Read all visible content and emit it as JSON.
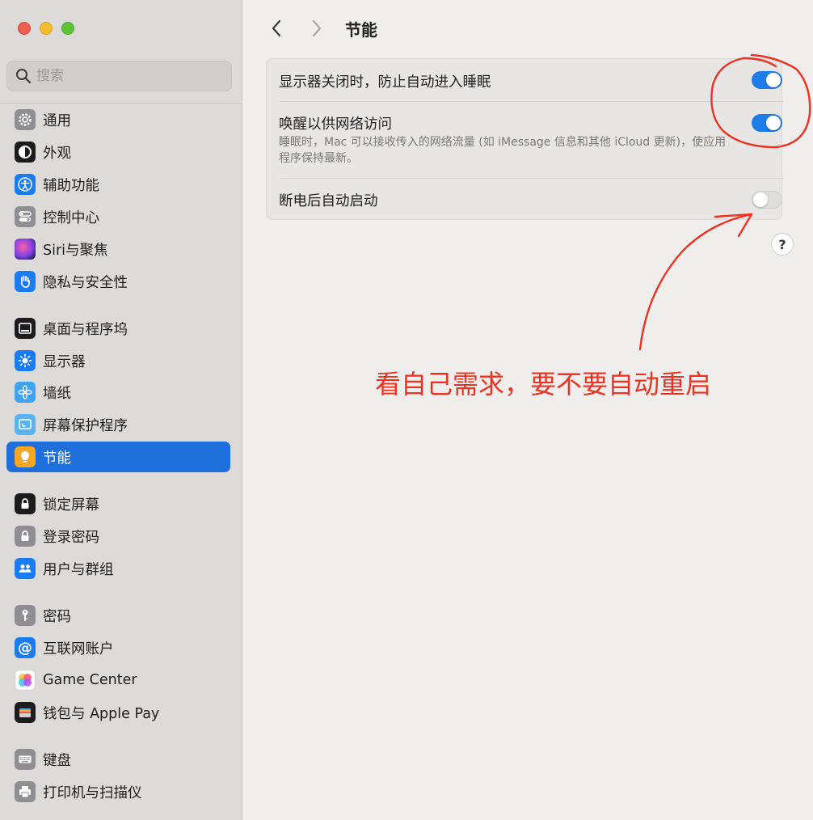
{
  "window": {
    "traffic_lights": [
      "close",
      "minimize",
      "zoom"
    ]
  },
  "search": {
    "placeholder": "搜索"
  },
  "sidebar": {
    "items": [
      {
        "label": "通用",
        "icon": "gear-icon",
        "color": "#8e8e93"
      },
      {
        "label": "外观",
        "icon": "appearance-icon",
        "color": "#1c1c1e"
      },
      {
        "label": "辅助功能",
        "icon": "accessibility-icon",
        "color": "#1a7cf2"
      },
      {
        "label": "控制中心",
        "icon": "control-center-icon",
        "color": "#8e8e93"
      },
      {
        "label": "Siri与聚焦",
        "icon": "siri-icon",
        "color": "#9b3fd0"
      },
      {
        "label": "隐私与安全性",
        "icon": "hand-icon",
        "color": "#1a7cf2"
      },
      {
        "label": "桌面与程序坞",
        "icon": "dock-icon",
        "color": "#1c1c1e"
      },
      {
        "label": "显示器",
        "icon": "sun-icon",
        "color": "#1a7cf2"
      },
      {
        "label": "墙纸",
        "icon": "flower-icon",
        "color": "#3fa3f2"
      },
      {
        "label": "屏幕保护程序",
        "icon": "screensaver-icon",
        "color": "#5ab3f0"
      },
      {
        "label": "节能",
        "icon": "lightbulb-icon",
        "color": "#f5a623",
        "active": true
      },
      {
        "label": "锁定屏幕",
        "icon": "lock-screen-icon",
        "color": "#1c1c1e"
      },
      {
        "label": "登录密码",
        "icon": "lock-icon",
        "color": "#8e8e93"
      },
      {
        "label": "用户与群组",
        "icon": "users-icon",
        "color": "#1a7cf2"
      },
      {
        "label": "密码",
        "icon": "key-icon",
        "color": "#8e8e93"
      },
      {
        "label": "互联网账户",
        "icon": "at-icon",
        "color": "#1a7cf2"
      },
      {
        "label": "Game Center",
        "icon": "game-center-icon",
        "color": "#ffffff"
      },
      {
        "label": "钱包与 Apple Pay",
        "icon": "wallet-icon",
        "color": "#1c1c1e"
      },
      {
        "label": "键盘",
        "icon": "keyboard-icon",
        "color": "#8e8e93"
      },
      {
        "label": "打印机与扫描仪",
        "icon": "printer-icon",
        "color": "#8e8e93"
      }
    ]
  },
  "header": {
    "back_icon": "chevron-left-icon",
    "forward_icon": "chevron-right-icon",
    "title": "节能"
  },
  "settings": {
    "rows": [
      {
        "label": "显示器关闭时，防止自动进入睡眠",
        "on": true
      },
      {
        "label": "唤醒以供网络访问",
        "description": "睡眠时，Mac 可以接收传入的网络流量 (如 iMessage 信息和其他 iCloud 更新)，使应用程序保持最新。",
        "on": true
      },
      {
        "label": "断电后自动启动",
        "on": false
      }
    ],
    "help_label": "?"
  },
  "annotation": {
    "text": "看自己需求，要不要自动重启",
    "color": "#ea3323"
  },
  "colors": {
    "accent": "#1f7ce8",
    "sidebar_active": "#1e6fd9"
  }
}
